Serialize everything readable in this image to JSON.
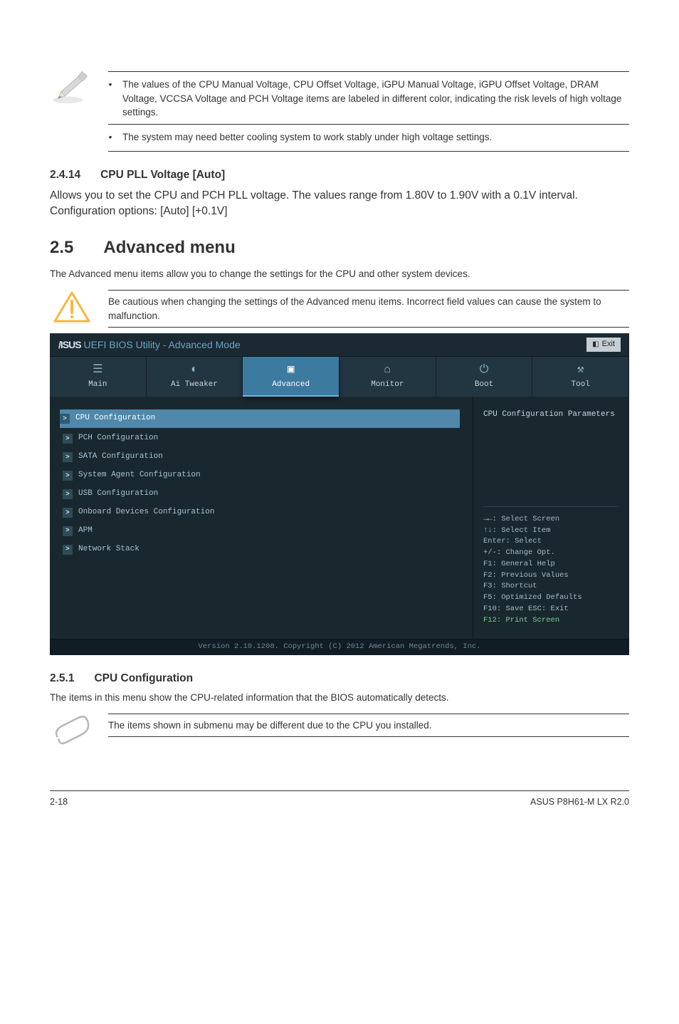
{
  "note1": {
    "items": [
      "The values of the CPU Manual Voltage, CPU Offset Voltage, iGPU Manual Voltage, iGPU Offset Voltage, DRAM Voltage, VCCSA Voltage and PCH Voltage items are labeled in different color, indicating the risk levels of high voltage settings.",
      "The system may need better cooling system to work stably under high voltage settings."
    ]
  },
  "sec_2_4_14": {
    "num": "2.4.14",
    "title": "CPU PLL Voltage [Auto]",
    "body": "Allows you to set the CPU and PCH PLL voltage. The values range from 1.80V to 1.90V with a 0.1V interval. Configuration options: [Auto] [+0.1V]"
  },
  "sec_2_5": {
    "num": "2.5",
    "title": "Advanced menu",
    "body": "The Advanced menu items allow you to change the settings for the CPU and other system devices."
  },
  "note2": {
    "text": "Be cautious when changing the settings of the Advanced menu items. Incorrect field values can cause the system to malfunction."
  },
  "bios": {
    "brand": "/ISUS",
    "title_rest": " UEFI BIOS Utility - ",
    "title_mode": "Advanced Mode",
    "exit": "Exit",
    "tabs": [
      {
        "icon": "☰",
        "label": "Main"
      },
      {
        "icon": "◐",
        "label": "Ai Tweaker"
      },
      {
        "icon": "▣",
        "label": "Advanced"
      },
      {
        "icon": "⌂",
        "label": "Monitor"
      },
      {
        "icon": "⏻",
        "label": "Boot"
      },
      {
        "icon": "⚒",
        "label": "Tool"
      }
    ],
    "active_tab": 2,
    "items": [
      "CPU Configuration",
      "PCH Configuration",
      "SATA Configuration",
      "System Agent Configuration",
      "USB Configuration",
      "Onboard Devices Configuration",
      "APM",
      "Network Stack"
    ],
    "help_title": "CPU Configuration Parameters",
    "keys": [
      "→←: Select Screen",
      "↑↓: Select Item",
      "Enter: Select",
      "+/-: Change Opt.",
      "F1: General Help",
      "F2: Previous Values",
      "F3: Shortcut",
      "F5: Optimized Defaults",
      "F10: Save  ESC: Exit",
      "F12: Print Screen"
    ],
    "footer": "Version 2.10.1208. Copyright (C) 2012 American Megatrends, Inc."
  },
  "sec_2_5_1": {
    "num": "2.5.1",
    "title": "CPU Configuration",
    "body": "The items in this menu show the CPU-related information that the BIOS automatically detects."
  },
  "note3": {
    "text": "The items shown in submenu may be different due to the CPU you installed."
  },
  "footer": {
    "left": "2-18",
    "right": "ASUS P8H61-M LX R2.0"
  }
}
